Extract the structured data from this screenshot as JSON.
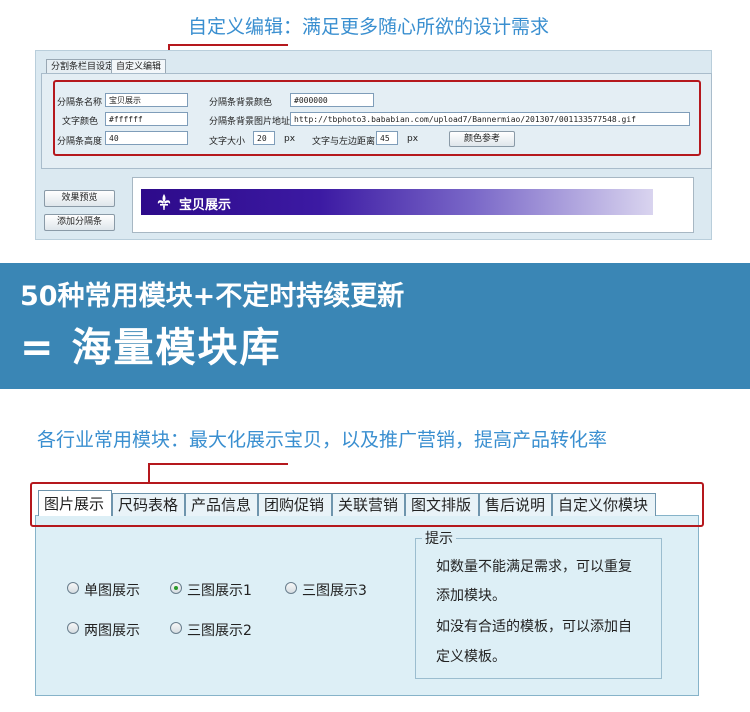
{
  "top_caption": "自定义编辑：满足更多随心所欲的设计需求",
  "editor": {
    "tabs": [
      "分割条栏目设定",
      "自定义编辑"
    ],
    "fields": {
      "name_label": "分隔条名称",
      "name_value": "宝贝展示",
      "bg_color_label": "分隔条背景颜色",
      "bg_color_value": "#000000",
      "text_color_label": "文字颜色",
      "text_color_value": "#ffffff",
      "bg_image_label": "分隔条背景图片地址",
      "bg_image_value": "http://tbphoto3.bababian.com/upload7/Bannermiao/201307/001133577548.gif",
      "height_label": "分隔条高度",
      "height_value": "40",
      "font_size_label": "文字大小",
      "font_size_value": "20",
      "font_size_unit": "px",
      "left_margin_label": "文字与左边距离",
      "left_margin_value": "45",
      "left_margin_unit": "px",
      "color_ref_button": "颜色参考"
    },
    "preview_button": "效果预览",
    "add_button": "添加分隔条",
    "banner_title": "宝贝展示"
  },
  "band": {
    "line1": "50种常用模块+不定时持续更新",
    "line2": "= 海量模块库"
  },
  "bottom_caption": "各行业常用模块：最大化展示宝贝，以及推广营销，提高产品转化率",
  "modules": {
    "tabs": [
      "图片展示",
      "尺码表格",
      "产品信息",
      "团购促销",
      "关联营销",
      "图文排版",
      "售后说明",
      "自定义你模块"
    ],
    "active_tab": "图片展示",
    "options": [
      "单图展示",
      "三图展示1",
      "三图展示3",
      "两图展示",
      "三图展示2"
    ],
    "selected_option": "三图展示1",
    "tip": {
      "title": "提示",
      "lines": [
        "如数量不能满足需求，可以重复",
        "添加模块。",
        "如没有合适的模板，可以添加自",
        "定义模板。"
      ]
    }
  },
  "colors": {
    "accent_blue": "#3a8fd0",
    "band_blue": "#3a86b5",
    "highlight_red": "#b5181d"
  }
}
